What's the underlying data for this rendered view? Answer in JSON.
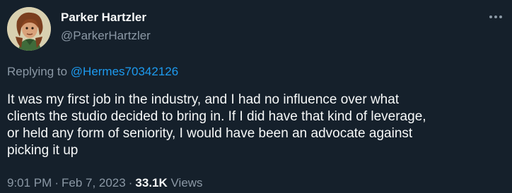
{
  "author": {
    "display_name": "Parker Hartzler",
    "handle": "@ParkerHartzler",
    "avatar_icon": "avatar-illustration-icon"
  },
  "more_icon": "more-horizontal-icon",
  "reply": {
    "prefix": "Replying to ",
    "mention": "@Hermes70342126"
  },
  "tweet": {
    "line1": "It was my first job in the industry, and I had no influence over what",
    "line2": "clients the studio decided to bring in. If I did have that kind of leverage,",
    "line3": "or held any form of seniority, I would have been an advocate against",
    "line4": "picking it up"
  },
  "meta": {
    "time": "9:01 PM",
    "separator": "·",
    "date": "Feb 7, 2023",
    "views_count": "33.1K",
    "views_label": " Views"
  },
  "colors": {
    "background": "#15202b",
    "text": "#f7f9f9",
    "secondary": "#8b98a5",
    "link": "#1d9bf0"
  }
}
